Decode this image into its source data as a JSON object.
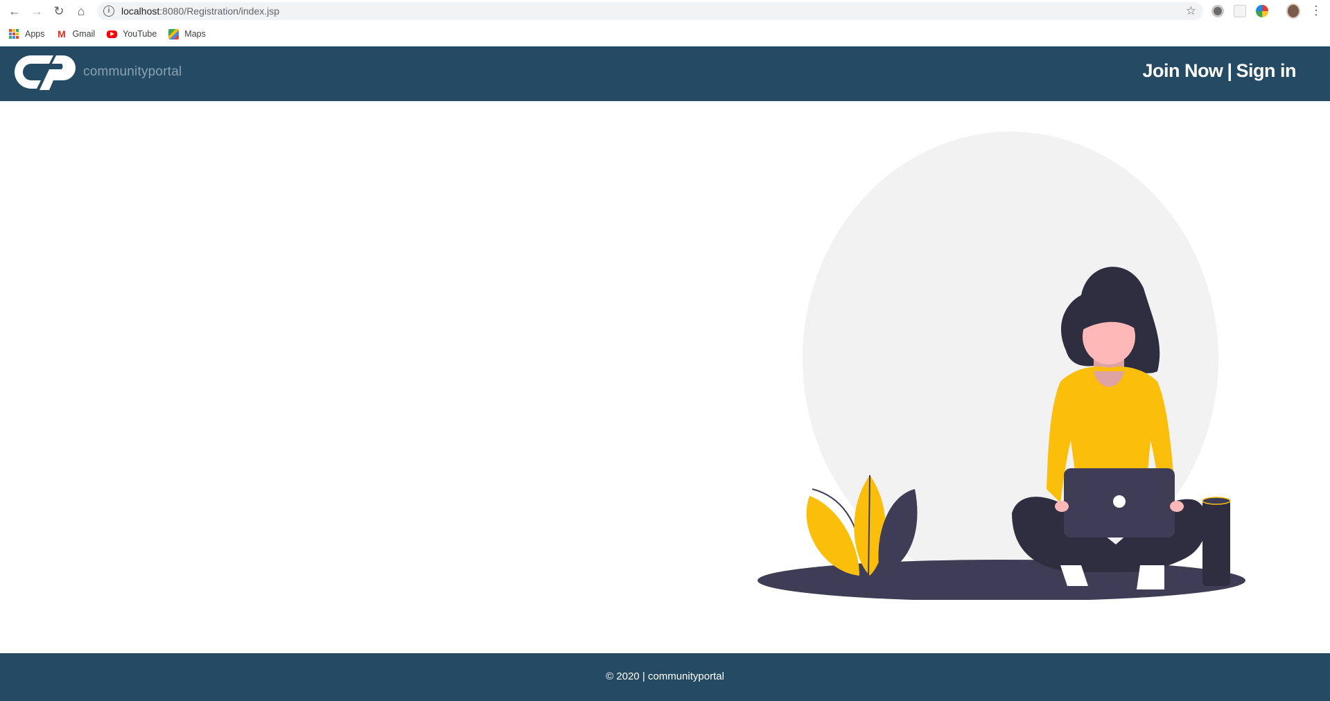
{
  "browser": {
    "url_host": "localhost",
    "url_rest": ":8080/Registration/index.jsp",
    "bookmarks": [
      {
        "label": "Apps",
        "icon": "apps-grid-icon"
      },
      {
        "label": "Gmail",
        "icon": "gmail-icon"
      },
      {
        "label": "YouTube",
        "icon": "youtube-icon"
      },
      {
        "label": "Maps",
        "icon": "maps-icon"
      }
    ]
  },
  "header": {
    "logo_text": "communityportal",
    "join_label": "Join Now",
    "separator": "|",
    "signin_label": "Sign in"
  },
  "hero": {
    "illustration": "woman-with-laptop-illustration"
  },
  "footer": {
    "text": "© 2020 | communityportal"
  },
  "colors": {
    "brand": "#244b63",
    "accent": "#fbbe0b",
    "dark": "#3f3d56"
  }
}
